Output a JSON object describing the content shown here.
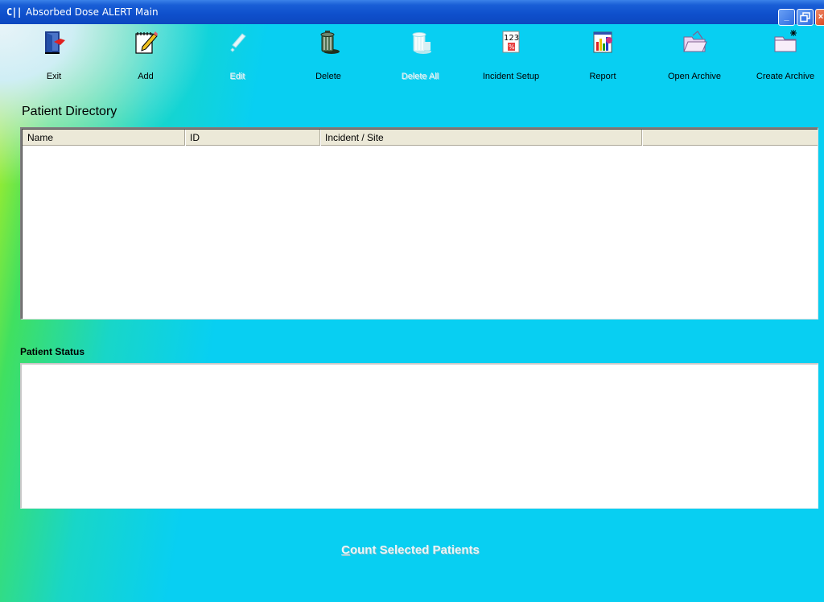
{
  "window": {
    "title": "Absorbed Dose ALERT  Main",
    "app_icon_text": "C||"
  },
  "toolbar": {
    "items": [
      {
        "label": "Exit",
        "icon": "exit-door-icon",
        "enabled": true
      },
      {
        "label": "Add",
        "icon": "pencil-notepad-icon",
        "enabled": true
      },
      {
        "label": "Edit",
        "icon": "edit-wand-icon",
        "enabled": false
      },
      {
        "label": "Delete",
        "icon": "trash-can-icon",
        "enabled": true
      },
      {
        "label": "Delete All",
        "icon": "trash-can-all-icon",
        "enabled": false
      },
      {
        "label": "Incident Setup",
        "icon": "incident-123-icon",
        "enabled": true
      },
      {
        "label": "Report",
        "icon": "bar-chart-report-icon",
        "enabled": true
      },
      {
        "label": "Open Archive",
        "icon": "open-folder-icon",
        "enabled": true
      },
      {
        "label": "Create Archive",
        "icon": "new-folder-icon",
        "enabled": true
      }
    ]
  },
  "patient_directory": {
    "title": "Patient Directory",
    "columns": [
      "Name",
      "ID",
      "Incident / Site",
      ""
    ],
    "rows": []
  },
  "patient_status": {
    "title": "Patient Status",
    "text": ""
  },
  "count_button": {
    "accel": "C",
    "rest": "ount Selected Patients"
  },
  "colors": {
    "titlebar": "#0e4fcc",
    "background": "#08cff2",
    "list_header": "#ece9d8"
  }
}
